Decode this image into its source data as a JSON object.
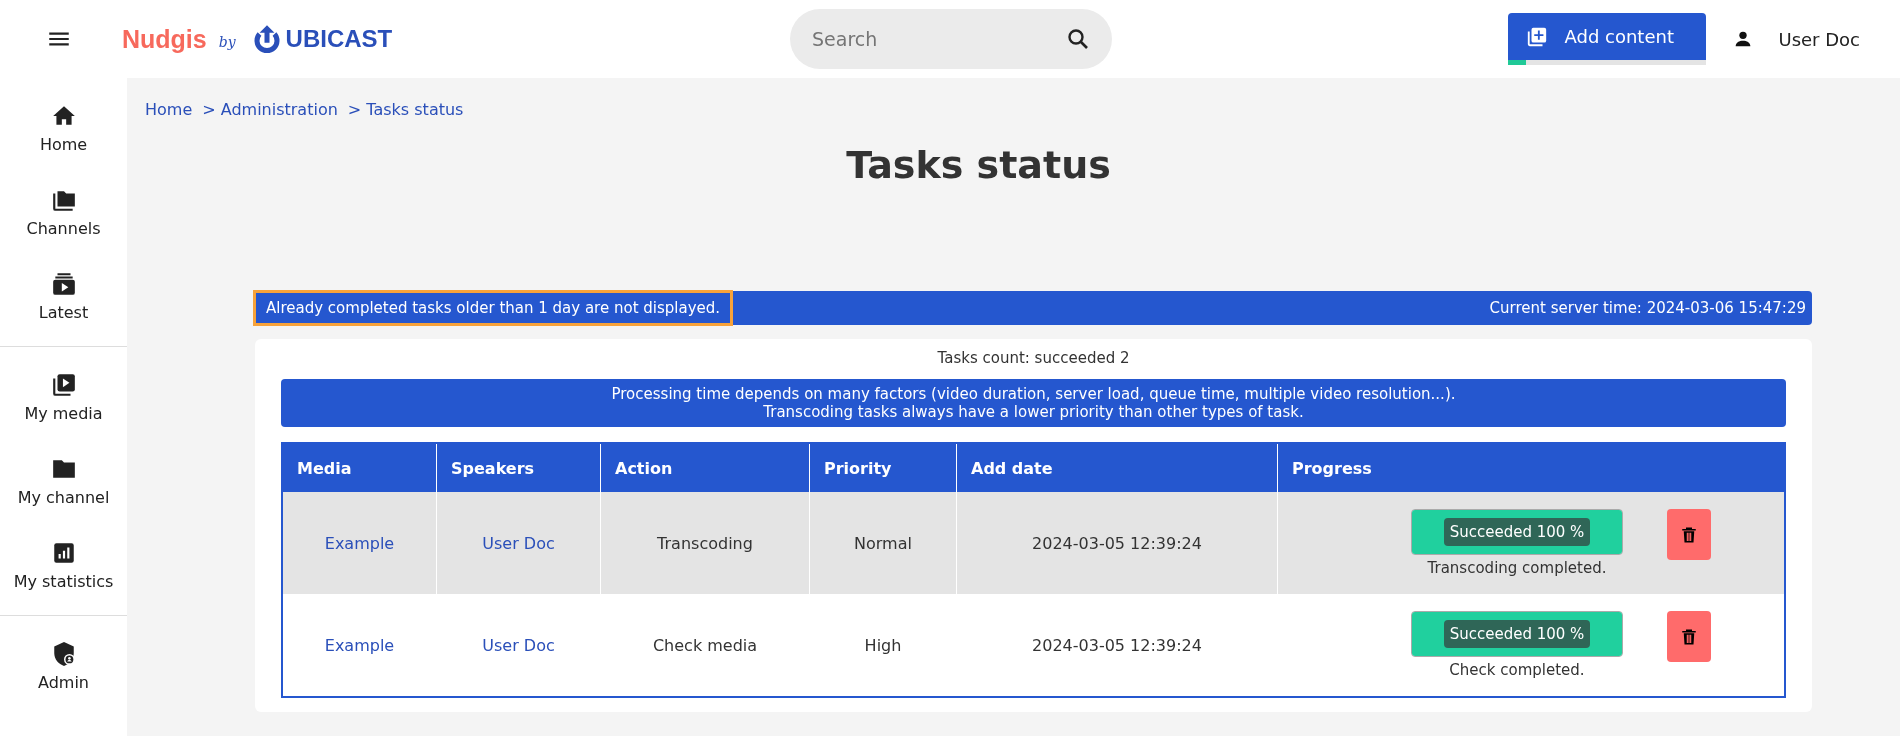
{
  "header": {
    "logo": {
      "brand": "Nudgis",
      "by": "by",
      "company": "UBICAST"
    },
    "search": {
      "placeholder": "Search"
    },
    "add_button": {
      "label": "Add content",
      "level": 0.09
    },
    "user": {
      "name": "User Doc"
    }
  },
  "sidebar": {
    "groups": [
      [
        {
          "kind": "home",
          "label": "Home"
        },
        {
          "kind": "channels",
          "label": "Channels"
        },
        {
          "kind": "latest",
          "label": "Latest"
        }
      ],
      [
        {
          "kind": "media",
          "label": "My media"
        },
        {
          "kind": "channel",
          "label": "My channel"
        },
        {
          "kind": "stats",
          "label": "My statistics"
        }
      ],
      [
        {
          "kind": "admin",
          "label": "Admin"
        }
      ]
    ]
  },
  "breadcrumb": [
    "Home",
    "> Administration",
    "> Tasks status"
  ],
  "title": "Tasks status",
  "notice": {
    "left": "Already completed tasks older than 1 day are not displayed.",
    "highlighted": true,
    "right": "Current server time: 2024-03-06 15:47:29"
  },
  "tasks_count": "Tasks count: succeeded 2",
  "info": [
    "Processing time depends on many factors (video duration, server load, queue time, multiple video resolution...).",
    "Transcoding tasks always have a lower priority than other types of task."
  ],
  "table": {
    "columns": [
      "Media",
      "Speakers",
      "Action",
      "Priority",
      "Add date",
      "Progress"
    ],
    "rows": [
      {
        "media": "Example",
        "speakers": "User Doc",
        "action": "Transcoding",
        "priority": "Normal",
        "add_date": "2024-03-05 12:39:24",
        "status": "Succeeded 100 %",
        "level": 1,
        "message": "Transcoding completed.",
        "selected": true
      },
      {
        "media": "Example",
        "speakers": "User Doc",
        "action": "Check media",
        "priority": "High",
        "add_date": "2024-03-05 12:39:24",
        "status": "Succeeded 100 %",
        "level": 1,
        "message": "Check completed.",
        "selected": false
      }
    ]
  }
}
